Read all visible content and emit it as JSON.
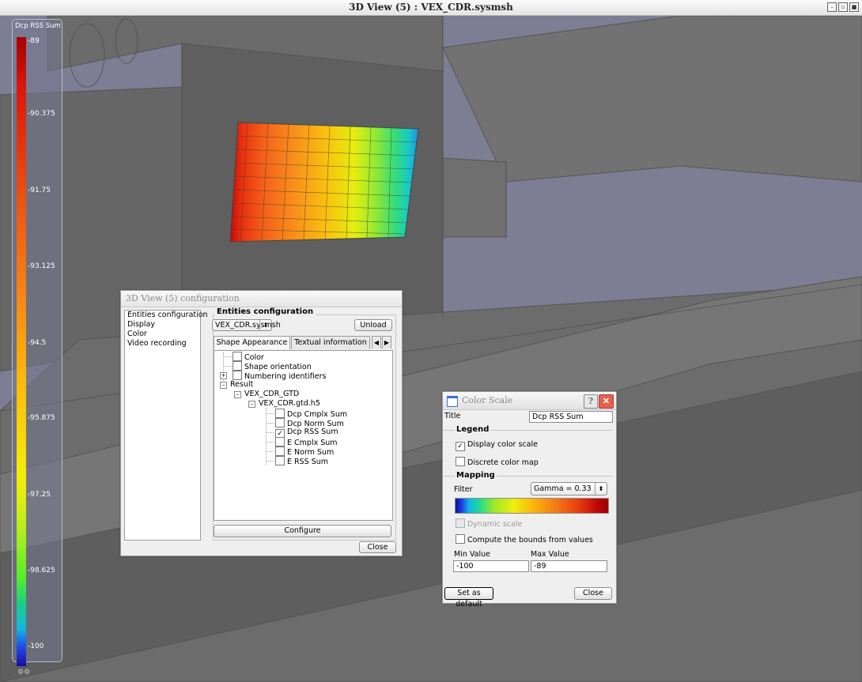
{
  "window": {
    "title": "3D View (5) : VEX_CDR.sysmsh"
  },
  "legend": {
    "title": "Dcp RSS Sum",
    "ticks": [
      "-89",
      "-90.375",
      "-91.75",
      "-93.125",
      "-94.5",
      "-95.875",
      "-97.25",
      "-98.625",
      "-100"
    ]
  },
  "config_dialog": {
    "title": "3D View (5) configuration",
    "nav": [
      "Entities configuration",
      "Display",
      "Color",
      "Video recording"
    ],
    "group_title": "Entities configuration",
    "entity_select": "VEX_CDR.sysmsh",
    "unload_label": "Unload",
    "tabs": [
      "Shape Appearance",
      "Textual information"
    ],
    "tree": {
      "color": "Color",
      "shape_orientation": "Shape orientation",
      "numbering": "Numbering identifiers",
      "result": "Result",
      "gtd": "VEX_CDR_GTD",
      "h5": "VEX_CDR.gtd.h5",
      "items": [
        {
          "label": "Dcp Cmplx Sum",
          "checked": false
        },
        {
          "label": "Dcp Norm Sum",
          "checked": false
        },
        {
          "label": "Dcp RSS Sum",
          "checked": true
        },
        {
          "label": "E Cmplx Sum",
          "checked": false
        },
        {
          "label": "E Norm Sum",
          "checked": false
        },
        {
          "label": "E RSS Sum",
          "checked": false
        }
      ]
    },
    "configure_label": "Configure",
    "close_label": "Close"
  },
  "color_scale": {
    "title": "Color Scale",
    "title_label": "Title",
    "title_value": "Dcp RSS Sum",
    "legend_section": "Legend",
    "display_color_scale": "Display color scale",
    "display_checked": true,
    "discrete_color_map": "Discrete color map",
    "discrete_checked": false,
    "mapping_section": "Mapping",
    "filter_label": "Filter",
    "filter_value": "Gamma = 0.33",
    "dynamic_scale": "Dynamic scale",
    "compute_bounds": "Compute the bounds from values",
    "min_label": "Min Value",
    "max_label": "Max Value",
    "min_value": "-100",
    "max_value": "-89",
    "set_default": "Set as default",
    "close_label": "Close",
    "help_icon": "?",
    "close_icon": "✕"
  },
  "colors": {
    "background": "#7d7d93",
    "hot": "#c00a06",
    "cold": "#1e3ce8"
  }
}
